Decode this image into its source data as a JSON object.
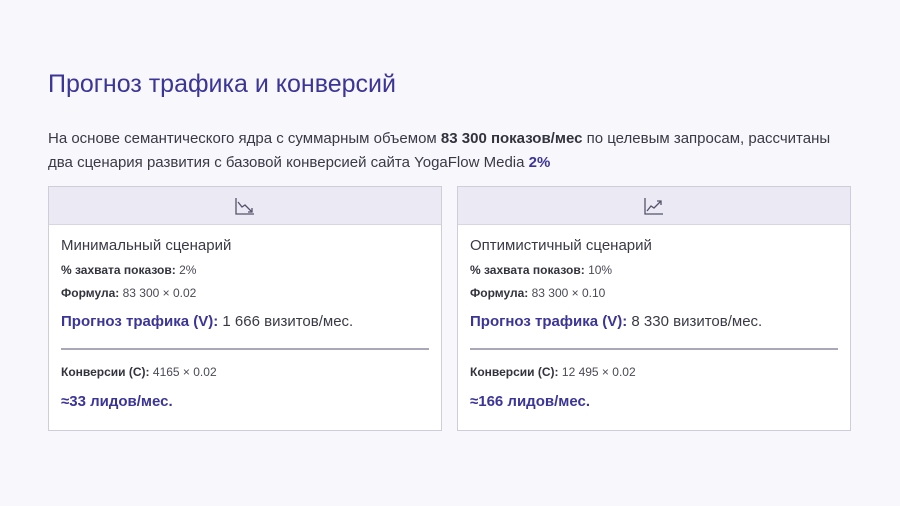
{
  "title": "Прогноз трафика и конверсий",
  "intro": {
    "text1": "На основе семантического ядра с суммарным объемом ",
    "volume": "83 300 показов/мес",
    "text2": " по целевым запросам, рассчитаны два сценария развития с базовой конверсией сайта YogaFlow Media ",
    "conversion": "2%"
  },
  "labels": {
    "capture": "% захвата показов:",
    "formula": "Формула:",
    "traffic": "Прогноз трафика (V):",
    "conversions": "Конверсии (C):"
  },
  "scenarios": [
    {
      "icon": "trend-down-icon",
      "name": "Минимальный сценарий",
      "capture": "2%",
      "formula": "83 300 × 0.02",
      "traffic": "1 666 визитов/мес.",
      "conversions": "4165 × 0.02",
      "leads": "≈33 лидов/мес."
    },
    {
      "icon": "trend-up-icon",
      "name": "Оптимистичный сценарий",
      "capture": "10%",
      "formula": "83 300 × 0.10",
      "traffic": "8 330 визитов/мес.",
      "conversions": "12 495 × 0.02",
      "leads": "≈166 лидов/мес."
    }
  ],
  "colors": {
    "accent": "#3b3597",
    "background": "#f8f7fc",
    "card_header": "#ebe9f4"
  }
}
